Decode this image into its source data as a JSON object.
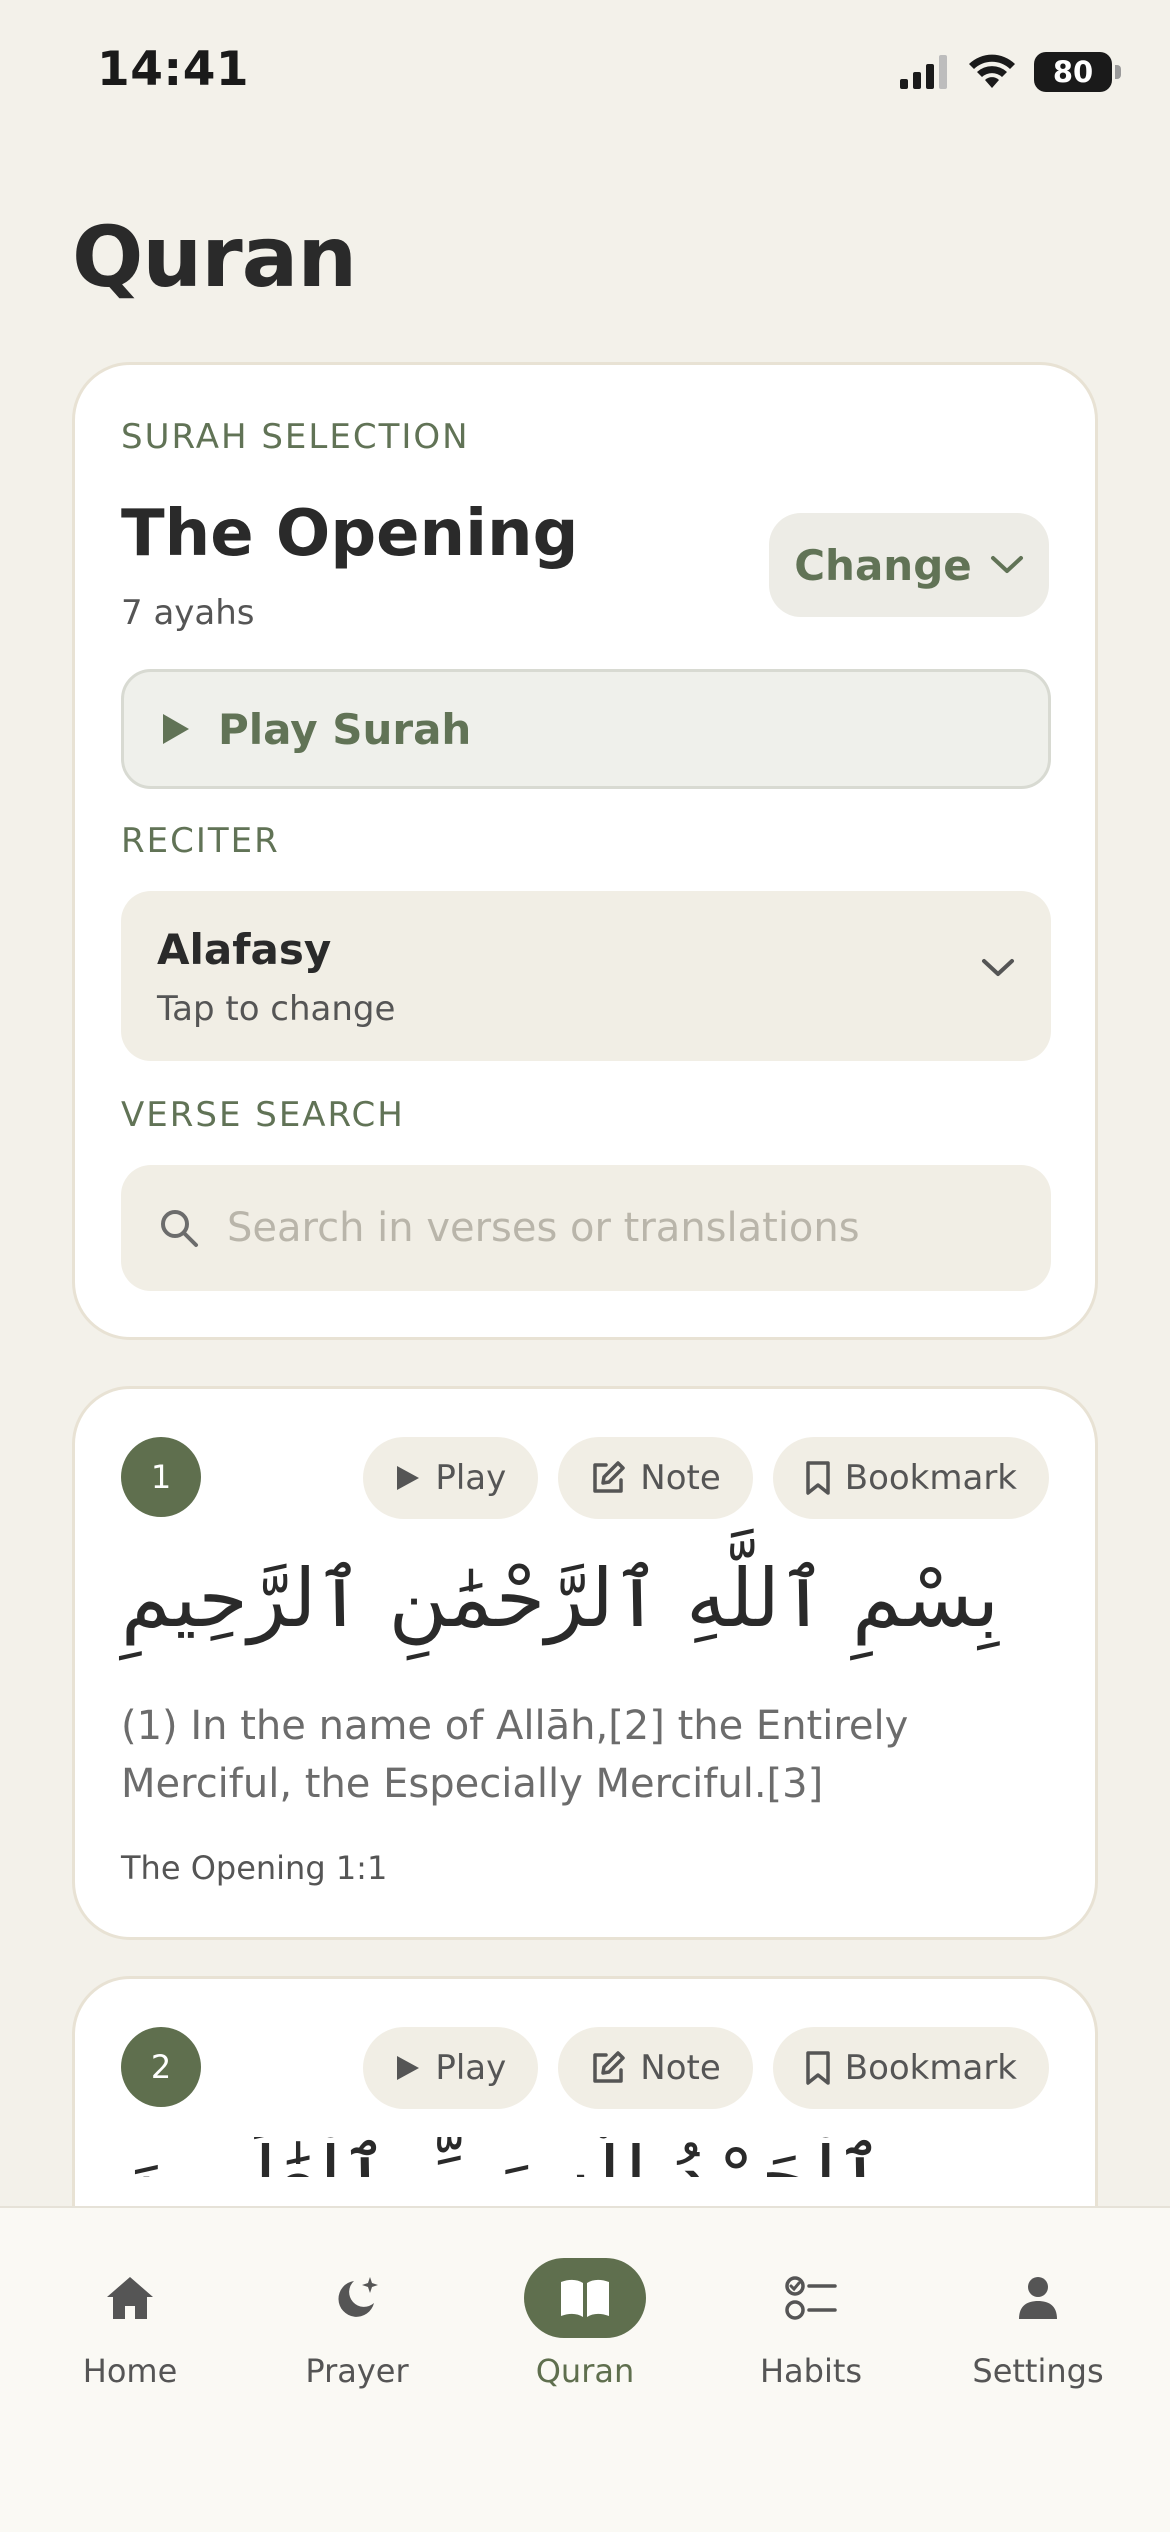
{
  "status_bar": {
    "time": "14:41",
    "battery": "80"
  },
  "page": {
    "title": "Quran"
  },
  "surah_selection": {
    "section_label": "SURAH SELECTION",
    "surah_name": "The Opening",
    "ayah_count": "7 ayahs",
    "change_label": "Change",
    "play_label": "Play Surah"
  },
  "reciter": {
    "section_label": "RECITER",
    "name": "Alafasy",
    "hint": "Tap to change"
  },
  "verse_search": {
    "section_label": "VERSE SEARCH",
    "placeholder": "Search in verses or translations"
  },
  "verse_actions": {
    "play": "Play",
    "note": "Note",
    "bookmark": "Bookmark"
  },
  "verses": [
    {
      "number": "1",
      "arabic": "بِسْمِ ٱللَّهِ ٱلرَّحْمَٰنِ ٱلرَّحِيمِ",
      "translation": "(1) In the name of Allāh,[2] the Entirely Merciful, the Especially Merciful.[3]",
      "reference": "The Opening 1:1"
    },
    {
      "number": "2",
      "arabic": "ٱلْحَمْدُ لِلَّهِ رَبِّ ٱلْعَٰلَمِينَ"
    }
  ],
  "tab_bar": {
    "tabs": [
      {
        "label": "Home",
        "icon": "home-icon"
      },
      {
        "label": "Prayer",
        "icon": "moon-star-icon"
      },
      {
        "label": "Quran",
        "icon": "open-book-icon",
        "active": true
      },
      {
        "label": "Habits",
        "icon": "checklist-icon"
      },
      {
        "label": "Settings",
        "icon": "person-icon"
      }
    ]
  },
  "colors": {
    "background": "#F3F1EA",
    "accent": "#5F6F4E",
    "accent_text": "#617356",
    "card": "#FFFFFF",
    "field": "#F1EEE5"
  }
}
